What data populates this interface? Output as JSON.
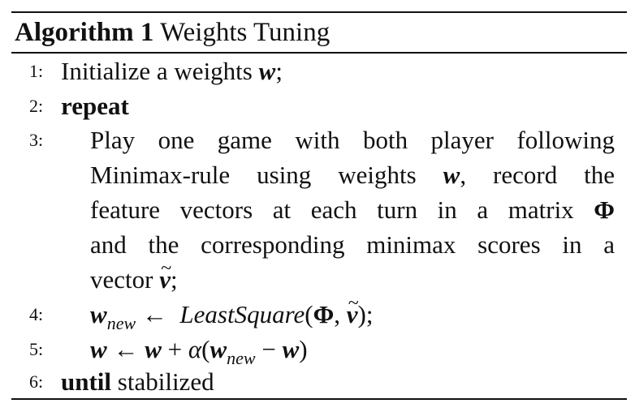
{
  "algorithm": {
    "label": "Algorithm 1",
    "name": "Weights Tuning"
  },
  "steps": [
    {
      "num": "1:",
      "text": "Initialize a weights",
      "var": "w",
      "end": ";"
    },
    {
      "num": "2:",
      "keyword": "repeat"
    },
    {
      "num": "3:",
      "lines": [
        "Play one game with both player following",
        "Minimax-rule using weights",
        "record the",
        "feature vectors at each turn in a matrix",
        "and the corresponding minimax scores in a",
        "vector"
      ],
      "var_w": "w",
      "phi": "Φ",
      "var_v": "v",
      "comma": ",",
      "end": ";"
    },
    {
      "num": "4:",
      "lhs": "w",
      "lhs_sub": "new",
      "arrow": "←",
      "func": "LeastSquare",
      "open": "(",
      "arg1": "Φ",
      "sep": ",",
      "arg2": "v",
      "close": ");"
    },
    {
      "num": "5:",
      "lhs": "w",
      "arrow": "←",
      "w2": "w",
      "plus": "+",
      "alpha": "α",
      "open": "(",
      "wnew": "w",
      "wnew_sub": "new",
      "minus": "−",
      "w3": "w",
      "close": ")"
    },
    {
      "num": "6:",
      "keyword": "until",
      "text": "stabilized"
    }
  ]
}
